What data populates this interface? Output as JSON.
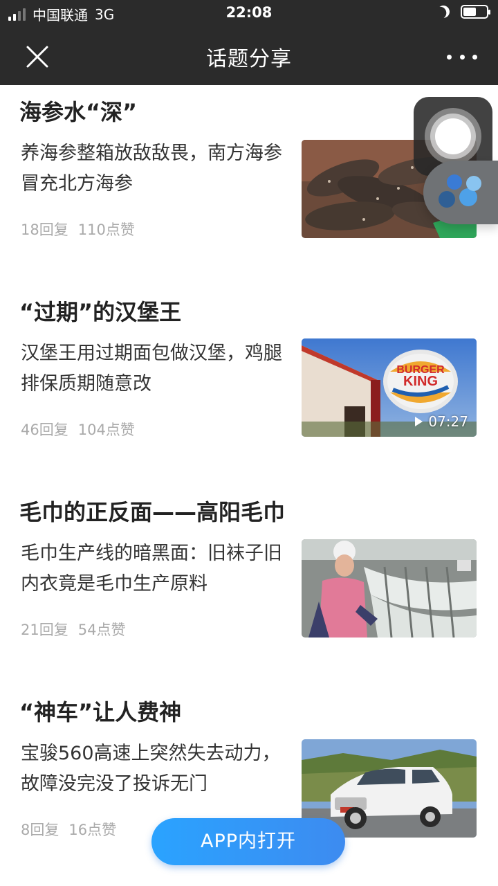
{
  "status_bar": {
    "carrier": "中国联通",
    "network": "3G",
    "time": "22:08",
    "battery_percent": 55
  },
  "nav": {
    "title": "话题分享",
    "close_icon": "close-icon",
    "more_icon": "more-icon"
  },
  "topics": [
    {
      "title": "海参水“深”",
      "desc": "养海参整箱放敌敌畏，南方海参冒充北方海参",
      "replies": "18回复",
      "likes": "110点赞",
      "image": "sea-cucumber-photo"
    },
    {
      "title": "“过期”的汉堡王",
      "desc": "汉堡王用过期面包做汉堡，鸡腿排保质期随意改",
      "replies": "46回复",
      "likes": "104点赞",
      "image": "burger-king-photo",
      "video_duration": "07:27"
    },
    {
      "title": "毛巾的正反面——高阳毛巾",
      "desc": "毛巾生产线的暗黑面：旧袜子旧内衣竟是毛巾生产原料",
      "replies": "21回复",
      "likes": "54点赞",
      "image": "towel-factory-photo"
    },
    {
      "title": "“神车”让人费神",
      "desc": "宝骏560高速上突然失去动力，故障没完没了投诉无门",
      "replies": "8回复",
      "likes": "16点赞",
      "image": "suv-car-photo"
    }
  ],
  "open_app": {
    "label": "APP内打开"
  },
  "colors": {
    "header_bg": "#2b2b2b",
    "button_gradient_start": "#2aa3ff",
    "button_gradient_end": "#3d8bf0",
    "meta_text": "#aaaaaa"
  }
}
